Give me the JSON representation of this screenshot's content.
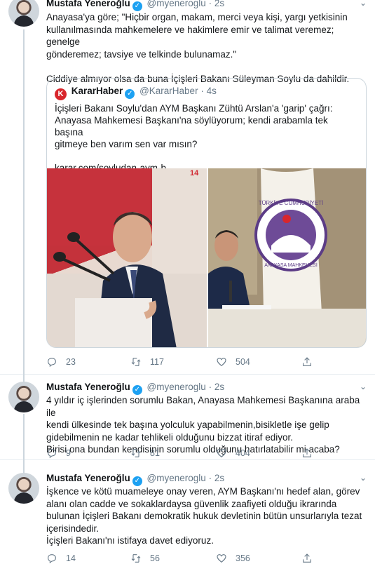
{
  "tweets": [
    {
      "author_name": "Mustafa Yeneroğlu",
      "handle": "@myeneroglu",
      "time": "2s",
      "text_lines": [
        "Anayasa'ya göre; \"Hiçbir organ, makam, merci veya kişi, yargı yetkisinin",
        "kullanılmasında mahkemelere ve hakimlere emir ve talimat veremez; genelge",
        "gönderemez; tavsiye ve telkinde bulunamaz.\"",
        "",
        "Ciddiye almıyor olsa da buna İçişleri Bakanı Süleyman Soylu da dahildir."
      ],
      "replies": "23",
      "retweets": "117",
      "likes": "504"
    },
    {
      "author_name": "Mustafa Yeneroğlu",
      "handle": "@myeneroglu",
      "time": "2s",
      "text_lines": [
        "4 yıldır iç işlerinden sorumlu Bakan, Anayasa Mahkemesi Başkanına araba ile",
        "kendi ülkesinde tek başına yolculuk yapabilmenin,bisikletle işe gelip",
        "gidebilmenin ne kadar tehlikeli olduğunu bizzat itiraf ediyor.",
        "Birisi ona bundan kendisinin sorumlu olduğunu hatırlatabilir mi acaba?"
      ],
      "replies": "9",
      "retweets": "81",
      "likes": "404"
    },
    {
      "author_name": "Mustafa Yeneroğlu",
      "handle": "@myeneroglu",
      "time": "2s",
      "text_lines": [
        "İşkence ve kötü muameleye onay veren, AYM Başkanı'nı hedef alan, görev",
        "alanı olan cadde ve sokaklardaysa güvenlik zaafiyeti olduğu ikrarında",
        "bulunan İçişleri Bakanı demokratik hukuk devletinin bütün unsurlarıyla tezat",
        "içerisindedir.",
        "İçişleri Bakanı'nı istifaya davet ediyoruz."
      ],
      "replies": "14",
      "retweets": "56",
      "likes": "356"
    }
  ],
  "quoted": {
    "logo_letter": "K",
    "name": "KararHaber",
    "handle": "@KararHaber",
    "time": "4s",
    "text_lines": [
      "İçişleri Bakanı Soylu'dan AYM Başkanı Zühtü Arslan'a 'garip' çağrı:",
      "Anayasa Mahkemesi Başkanı'na söylüyorum; kendi arabamla tek başına",
      "gitmeye ben varım sen var mısın?"
    ],
    "link": "karar.com/soyludan-aym-b...",
    "image_left_number": "14",
    "seal_text_top": "TÜRKİYE CUMHURİYETİ",
    "seal_text_bottom": "ANAYASA MAHKEMESİ"
  },
  "icons": {
    "reply": "reply-icon",
    "retweet": "retweet-icon",
    "like": "heart-icon",
    "share": "share-icon",
    "verified": "verified-badge-icon",
    "caret": "chevron-down-icon"
  },
  "colors": {
    "verified": "#1da1f2",
    "muted": "#657786",
    "border": "#e6ecf0",
    "brand_red": "#d8262c"
  }
}
